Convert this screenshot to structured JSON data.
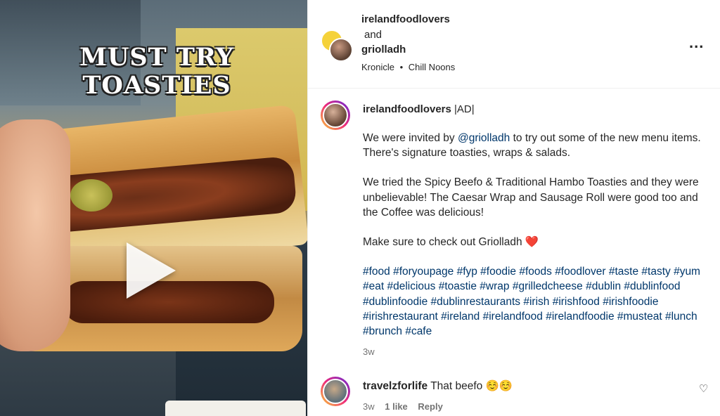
{
  "media": {
    "overlay_line1": "MUST TRY",
    "overlay_line2": "TOASTIES"
  },
  "header": {
    "user1": "irelandfoodlovers",
    "and": "and",
    "user2": "griolladh",
    "audio_artist": "Kronicle",
    "separator": "•",
    "audio_track": "Chill Noons",
    "more_label": "..."
  },
  "caption": {
    "username": "irelandfoodlovers",
    "ad_tag": " |AD|",
    "p1_before": "We were invited by ",
    "p1_mention": "@griolladh",
    "p1_after": " to try out some of the new menu items. There's signature toasties, wraps & salads.",
    "p2": "We tried the Spicy Beefo & Traditional Hambo Toasties and they were unbelievable! The Caesar Wrap and Sausage Roll were good too and the Coffee was delicious!",
    "p3": "Make sure to check out Griolladh ",
    "p3_emoji": "❤️",
    "hashtags": "#food #foryoupage #fyp #foodie #foods #foodlover #taste #tasty #yum #eat #delicious #toastie #wrap #grilledcheese #dublin #dublinfood #dublinfoodie #dublinrestaurants #irish #irishfood #irishfoodie #irishrestaurant #ireland #irelandfood #irelandfoodie #musteat #lunch #brunch #cafe",
    "time": "3w"
  },
  "comment": {
    "username": "travelzforlife",
    "text": " That beefo ☺️☺️",
    "time": "3w",
    "likes": "1 like",
    "reply": "Reply"
  },
  "icons": {
    "more": "more-options-icon",
    "heart": "heart-icon",
    "play": "play-icon"
  }
}
